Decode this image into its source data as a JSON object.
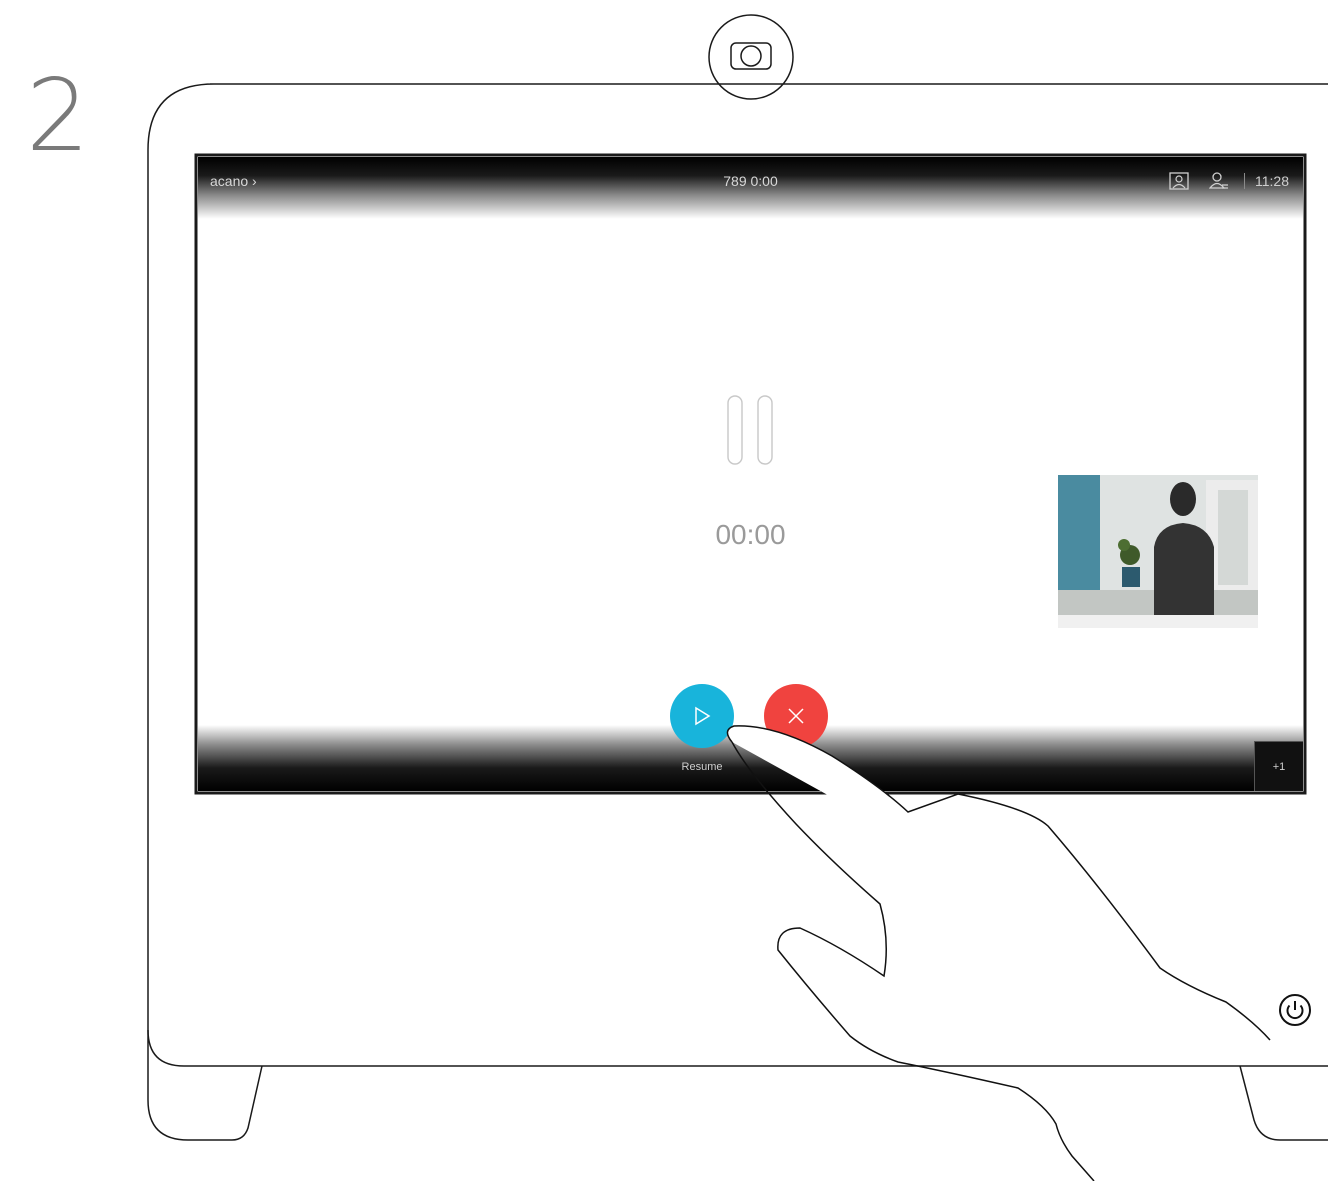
{
  "step": {
    "number": "2"
  },
  "topbar": {
    "call_name": "acano",
    "chevron": "›",
    "call_info": "789  0:00",
    "time": "11:28",
    "icons": [
      "selfview-icon",
      "participants-icon"
    ]
  },
  "hold": {
    "icon": "pause-icon",
    "timer": "00:00"
  },
  "controls": {
    "resume": {
      "label": "Resume",
      "icon": "play-icon",
      "color": "#18b4db"
    },
    "end": {
      "label": "",
      "icon": "close-icon",
      "color": "#f0433f"
    },
    "more": {
      "label": "+1"
    }
  },
  "device": {
    "power_icon": "power-icon"
  }
}
